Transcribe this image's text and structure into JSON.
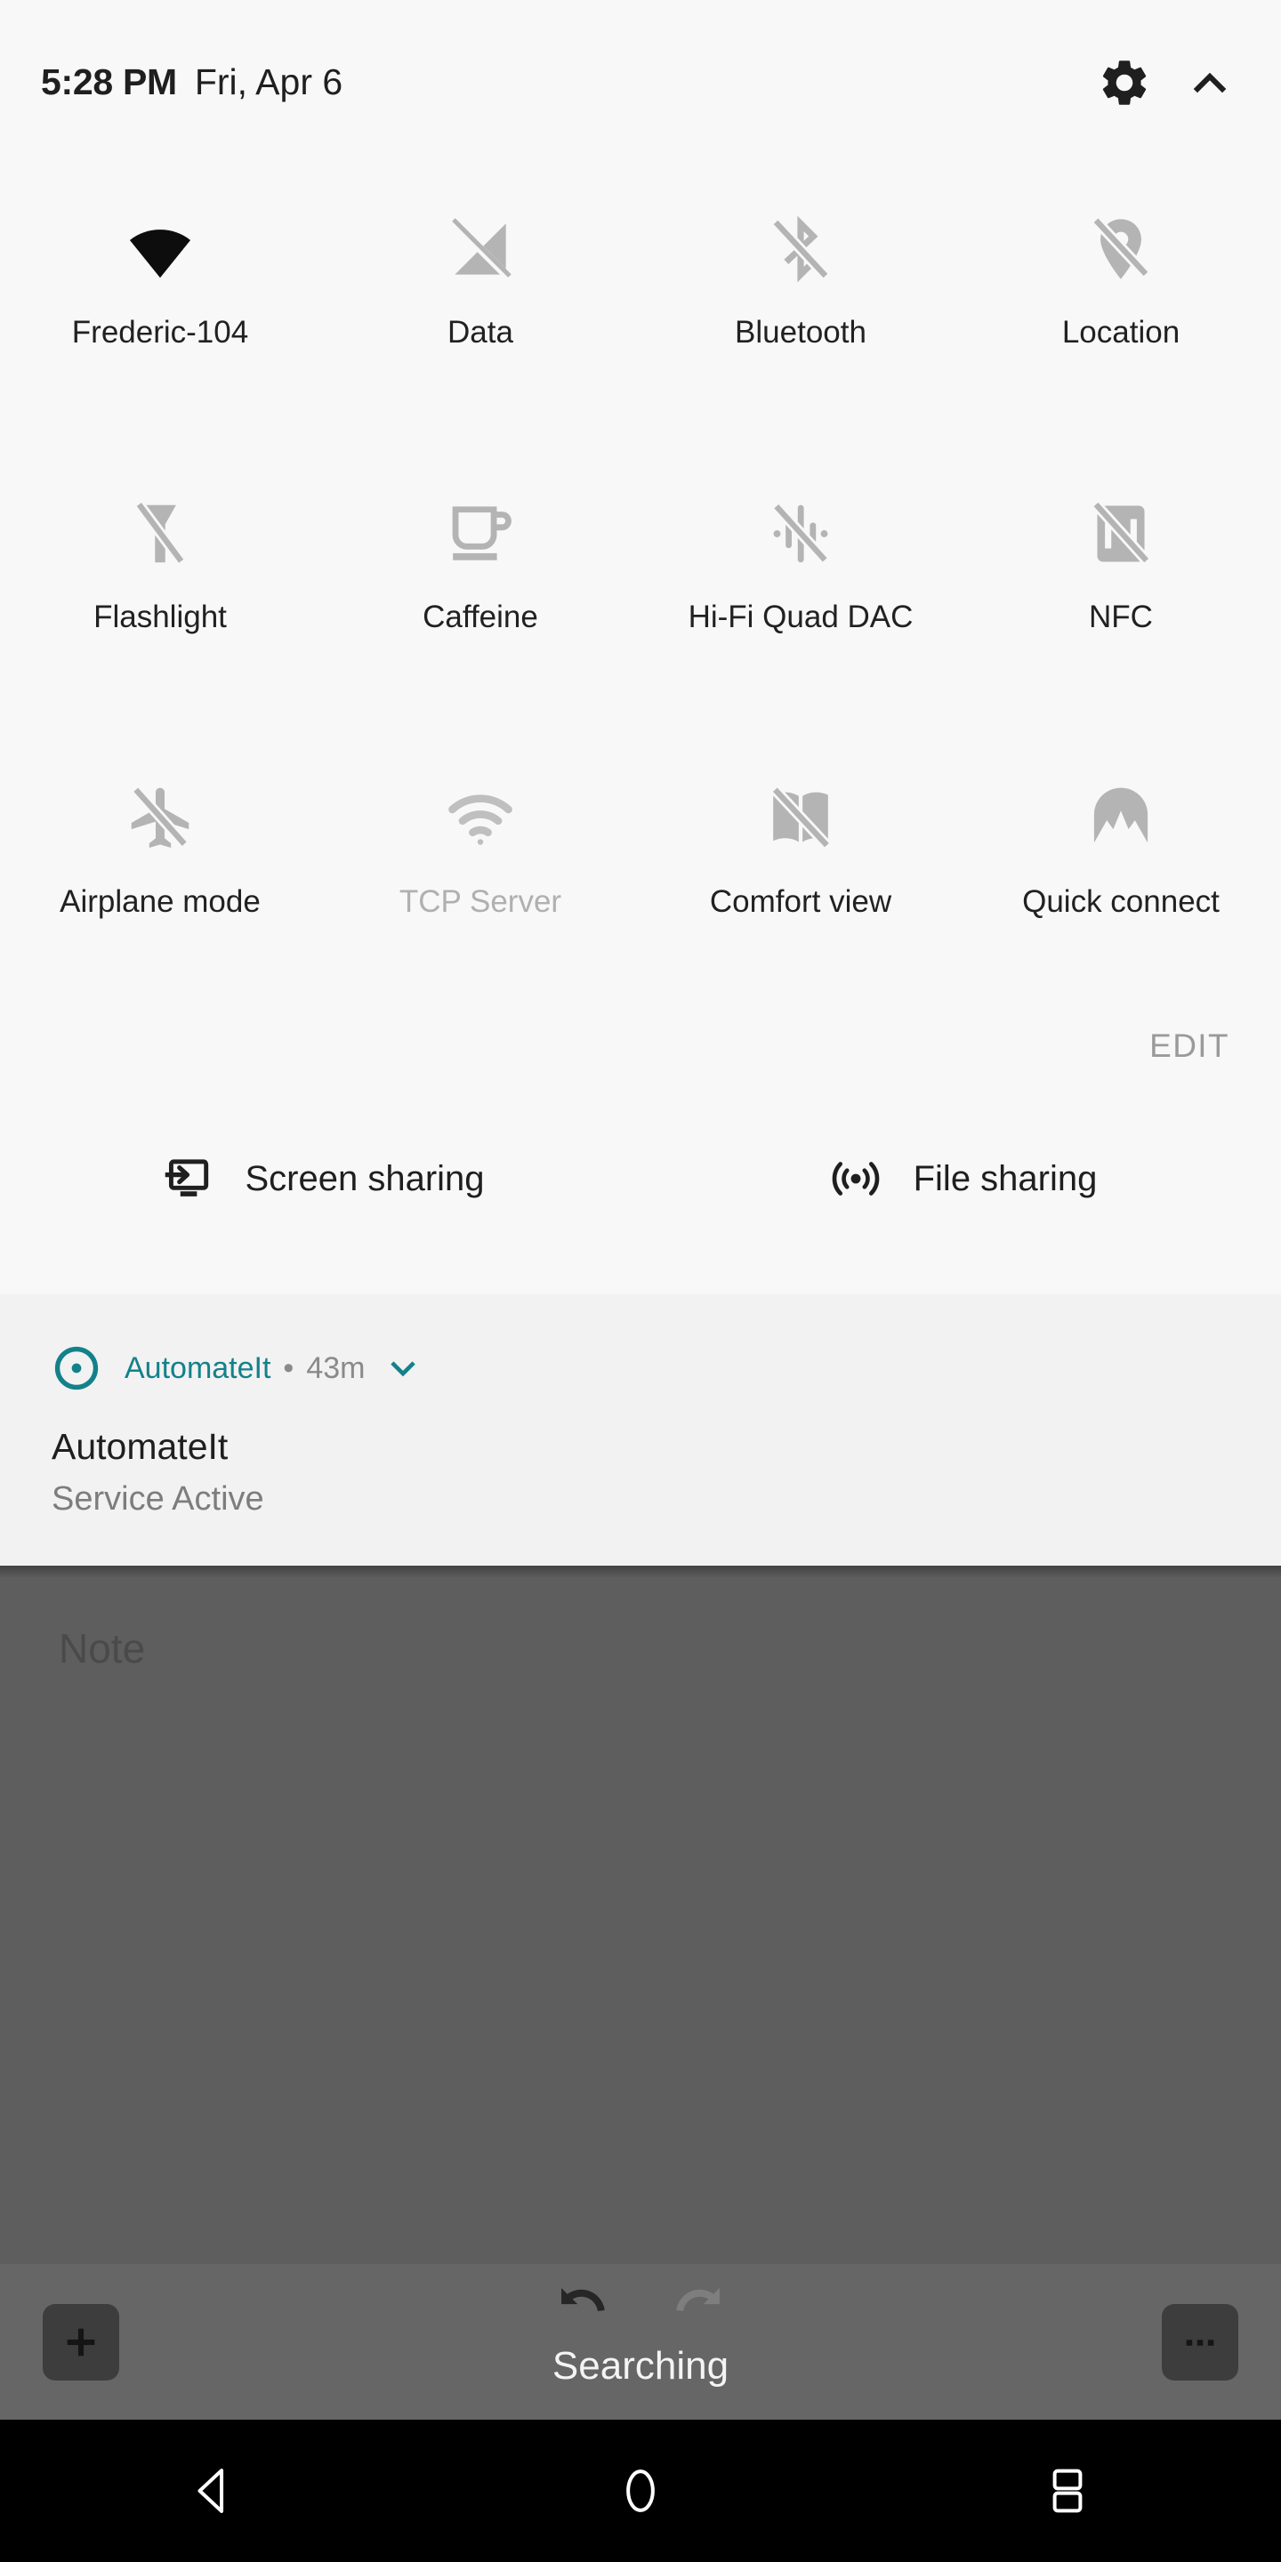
{
  "statusbar": {
    "clock": "5:28 PM",
    "date": "Fri, Apr 6",
    "settings_icon": "gear-icon",
    "collapse_icon": "chevron-up-icon"
  },
  "quick_settings": {
    "edit_label": "EDIT",
    "tiles": [
      {
        "label": "Frederic-104",
        "icon": "wifi-icon",
        "state": "on",
        "label_muted": false
      },
      {
        "label": "Data",
        "icon": "mobile-data-off-icon",
        "state": "off",
        "label_muted": false
      },
      {
        "label": "Bluetooth",
        "icon": "bluetooth-off-icon",
        "state": "off",
        "label_muted": false
      },
      {
        "label": "Location",
        "icon": "location-off-icon",
        "state": "off",
        "label_muted": false
      },
      {
        "label": "Flashlight",
        "icon": "flashlight-off-icon",
        "state": "off",
        "label_muted": false
      },
      {
        "label": "Caffeine",
        "icon": "coffee-cup-icon",
        "state": "off",
        "label_muted": false
      },
      {
        "label": "Hi-Fi Quad DAC",
        "icon": "hifi-dac-off-icon",
        "state": "off",
        "label_muted": false
      },
      {
        "label": "NFC",
        "icon": "nfc-off-icon",
        "state": "off",
        "label_muted": false
      },
      {
        "label": "Airplane mode",
        "icon": "airplane-off-icon",
        "state": "off",
        "label_muted": false
      },
      {
        "label": "TCP Server",
        "icon": "wifi-signal-icon",
        "state": "unavailable",
        "label_muted": true
      },
      {
        "label": "Comfort view",
        "icon": "comfort-view-off-icon",
        "state": "off",
        "label_muted": false
      },
      {
        "label": "Quick connect",
        "icon": "quick-connect-icon",
        "state": "off",
        "label_muted": false
      }
    ],
    "sharing": [
      {
        "label": "Screen sharing",
        "icon": "screen-cast-icon"
      },
      {
        "label": "File sharing",
        "icon": "broadcast-icon"
      }
    ]
  },
  "notification": {
    "app_name": "AutomateIt",
    "separator": "•",
    "time": "43m",
    "title": "AutomateIt",
    "body": "Service Active",
    "app_icon": "automateit-ring-icon",
    "expand_icon": "chevron-down-icon",
    "accent_color": "#13818a"
  },
  "background_app": {
    "note_placeholder": "Note",
    "toast": "Searching",
    "toolbar": {
      "add_icon": "plus-icon",
      "undo_icon": "undo-icon",
      "redo_icon": "redo-icon",
      "more_icon": "overflow-menu-icon"
    }
  },
  "navbar": {
    "back_icon": "back-triangle-icon",
    "home_icon": "home-circle-icon",
    "recents_icon": "split-window-icon"
  }
}
